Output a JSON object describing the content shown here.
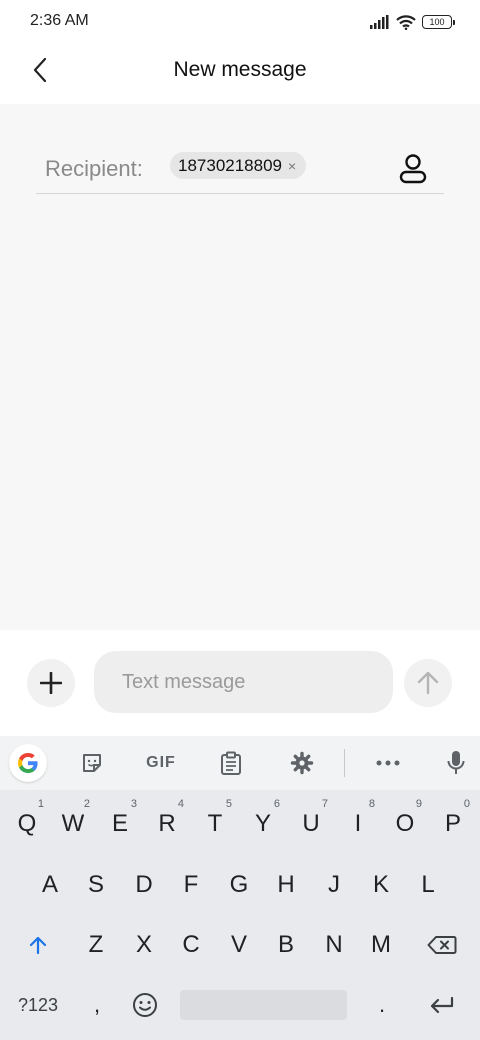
{
  "status": {
    "time": "2:36 AM",
    "battery": "100"
  },
  "header": {
    "title": "New message"
  },
  "recipient": {
    "label": "Recipient:",
    "chips": [
      "18730218809"
    ],
    "chip_remove": "×"
  },
  "compose": {
    "placeholder": "Text message"
  },
  "keyboard": {
    "toolbar": {
      "gif_label": "GIF"
    },
    "row1": [
      {
        "key": "Q",
        "hint": "1"
      },
      {
        "key": "W",
        "hint": "2"
      },
      {
        "key": "E",
        "hint": "3"
      },
      {
        "key": "R",
        "hint": "4"
      },
      {
        "key": "T",
        "hint": "5"
      },
      {
        "key": "Y",
        "hint": "6"
      },
      {
        "key": "U",
        "hint": "7"
      },
      {
        "key": "I",
        "hint": "8"
      },
      {
        "key": "O",
        "hint": "9"
      },
      {
        "key": "P",
        "hint": "0"
      }
    ],
    "row2": [
      "A",
      "S",
      "D",
      "F",
      "G",
      "H",
      "J",
      "K",
      "L"
    ],
    "row3": [
      "Z",
      "X",
      "C",
      "V",
      "B",
      "N",
      "M"
    ],
    "row4": {
      "symbols": "?123",
      "comma": ",",
      "period": "."
    }
  },
  "colors": {
    "accent": "#1a73e8",
    "header_bg": "#ffffff",
    "content_bg": "#f7f7f7",
    "keyboard_bg": "#e8eaed"
  }
}
